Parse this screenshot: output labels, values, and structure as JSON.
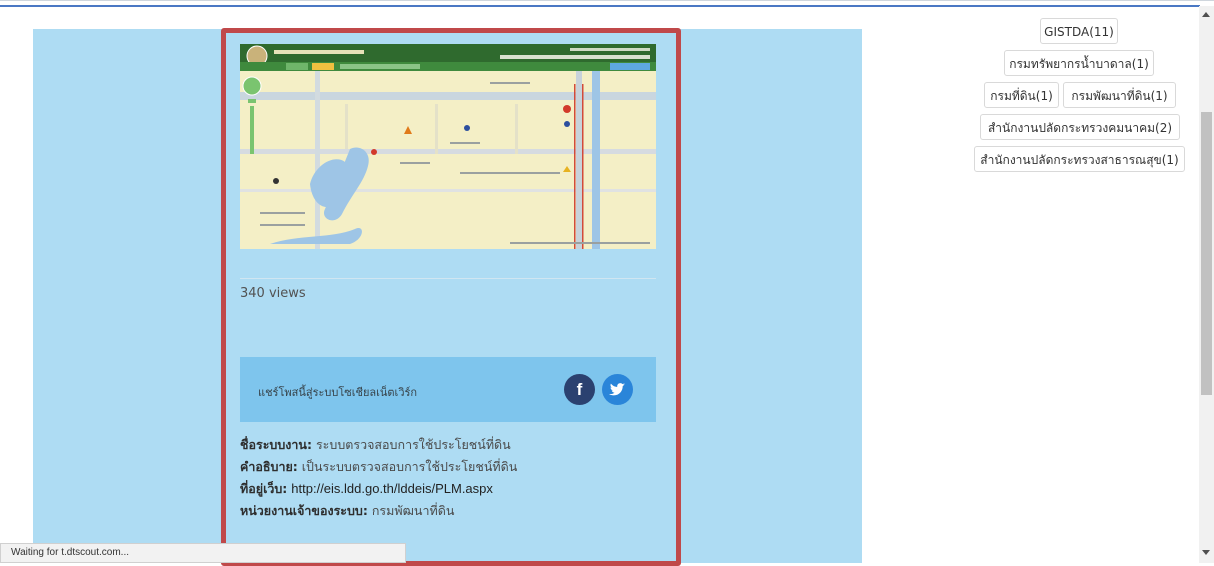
{
  "post": {
    "views": "340 views",
    "share_text": "แชร์โพสนี้สู่ระบบโซเชียลเน็ตเวิร์ก",
    "facebook_glyph": "f",
    "details": {
      "system_name_label": "ชื่อระบบงาน:",
      "system_name_value": "ระบบตรวจสอบการใช้ประโยชน์ที่ดิน",
      "description_label": "คำอธิบาย:",
      "description_value": "เป็นระบบตรวจสอบการใช้ประโยชน์ที่ดิน",
      "website_label": "ที่อยู่เว็บ:",
      "website_value": "http://eis.ldd.go.th/lddeis/PLM.aspx",
      "owner_label": "หน่วยงานเจ้าของระบบ:",
      "owner_value": "กรมพัฒนาที่ดิน"
    }
  },
  "tags": [
    "GISTDA(11)",
    "กรมทรัพยากรน้ำบาดาล(1)",
    "กรมที่ดิน(1)",
    "กรมพัฒนาที่ดิน(1)",
    "สำนักงานปลัดกระทรวงคมนาคม(2)",
    "สำนักงานปลัดกระทรวงสาธารณสุข(1)"
  ],
  "status_bar": "Waiting for t.dtscout.com...",
  "colors": {
    "panel_bg": "#aedcf3",
    "highlight_border": "#c0494a",
    "share_bg": "#7ec5ed",
    "facebook": "#2b4170",
    "twitter": "#2a85d9"
  }
}
